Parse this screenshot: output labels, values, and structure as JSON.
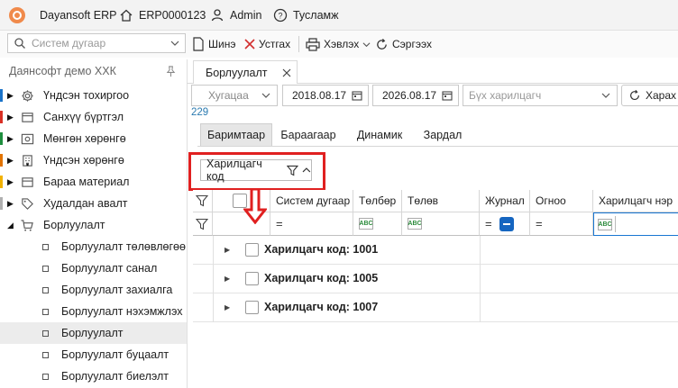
{
  "titlebar": {
    "app_name": "Dayansoft ERP",
    "org_code": "ERP0000123",
    "user": "Admin",
    "help": "Тусламж"
  },
  "toolbar": {
    "search_placeholder": "Систем дугаар",
    "new_label": "Шинэ",
    "delete_label": "Устгах",
    "print_label": "Хэвлэх",
    "refresh_label": "Сэргээх"
  },
  "sidebar": {
    "company": "Даянсофт демо ХХК",
    "items": [
      {
        "label": "Үндсэн тохиргоо",
        "icon": "gear-icon",
        "color": "#1a73c9"
      },
      {
        "label": "Санхүү бүртгэл",
        "icon": "ledger-icon",
        "color": "#d93025"
      },
      {
        "label": "Мөнгөн хөрөнгө",
        "icon": "cash-icon",
        "color": "#1e8e3e"
      },
      {
        "label": "Үндсэн хөрөнгө",
        "icon": "building-icon",
        "color": "#e37400"
      },
      {
        "label": "Бараа материал",
        "icon": "box-icon",
        "color": "#f2b200"
      },
      {
        "label": "Худалдан авалт",
        "icon": "tag-icon",
        "color": "#b0b0b0"
      },
      {
        "label": "Борлуулалт",
        "icon": "cart-icon",
        "color": ""
      }
    ],
    "subitems": [
      {
        "label": "Борлуулалт төлөвлөгөө"
      },
      {
        "label": "Борлуулалт санал"
      },
      {
        "label": "Борлуулалт захиалга"
      },
      {
        "label": "Борлуулалт нэхэмжлэх"
      },
      {
        "label": "Борлуулалт"
      },
      {
        "label": "Борлуулалт буцаалт"
      },
      {
        "label": "Борлуулалт биелэлт"
      }
    ]
  },
  "doc_tab": {
    "label": "Борлуулалт"
  },
  "filters": {
    "period": "Хугацаа",
    "date_from": "2018.08.17",
    "date_to": "2026.08.17",
    "partner_placeholder": "Бүх харилцагч",
    "search_button": "Харах"
  },
  "record_count": "229",
  "subtabs": [
    "Баримтаар",
    "Бараагаар",
    "Динамик",
    "Зардал"
  ],
  "group_chip": {
    "label": "Харилцагч код"
  },
  "columns": [
    "Систем дугаар",
    "Төлбөр",
    "Төлөв",
    "Журнал",
    "Огноо",
    "Харилцагч нэр"
  ],
  "groups": [
    {
      "label": "Харилцагч код: 1001"
    },
    {
      "label": "Харилцагч код: 1005"
    },
    {
      "label": "Харилцагч код: 1007"
    }
  ]
}
